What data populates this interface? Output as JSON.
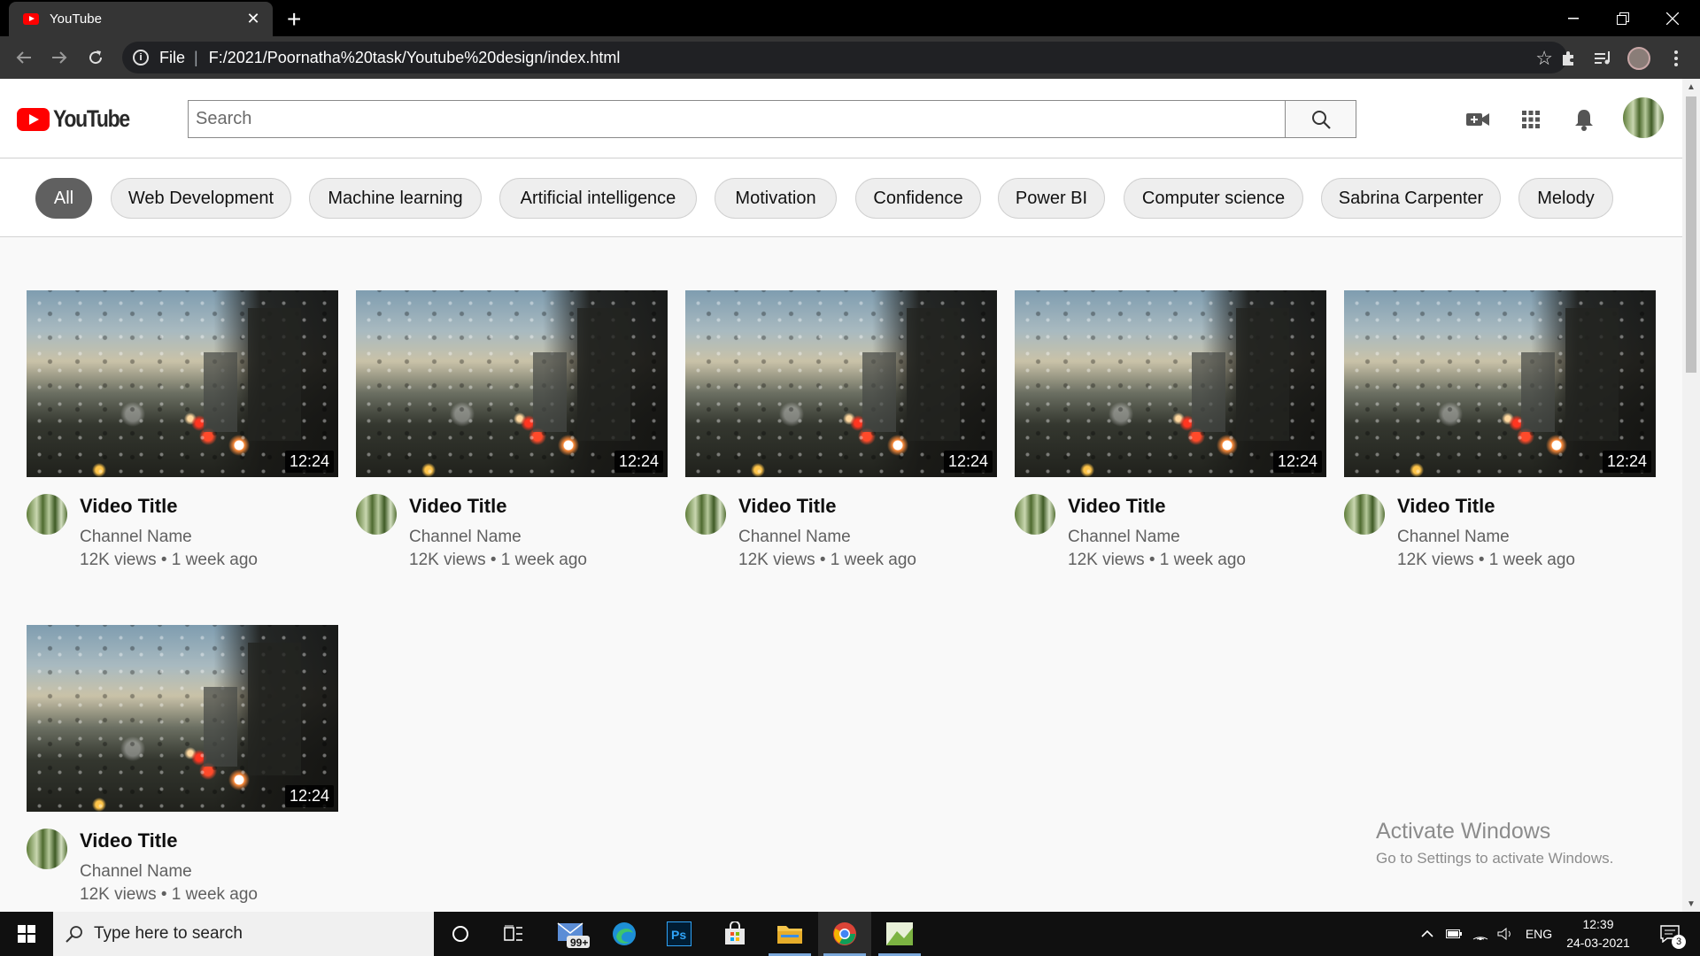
{
  "browser": {
    "tab_title": "YouTube",
    "url_scheme": "File",
    "url": "F:/2021/Poornatha%20task/Youtube%20design/index.html"
  },
  "header": {
    "logo_text": "YouTube",
    "search_placeholder": "Search"
  },
  "chips": [
    {
      "label": "All",
      "active": true
    },
    {
      "label": "Web Development"
    },
    {
      "label": "Machine learning"
    },
    {
      "label": "Artificial intelligence"
    },
    {
      "label": "Motivation"
    },
    {
      "label": "Confidence"
    },
    {
      "label": "Power BI"
    },
    {
      "label": "Computer science"
    },
    {
      "label": "Sabrina Carpenter"
    },
    {
      "label": "Melody"
    }
  ],
  "videos": [
    {
      "title": "Video Title",
      "channel": "Channel Name",
      "stats": "12K views • 1 week ago",
      "duration": "12:24"
    },
    {
      "title": "Video Title",
      "channel": "Channel Name",
      "stats": "12K views • 1 week ago",
      "duration": "12:24"
    },
    {
      "title": "Video Title",
      "channel": "Channel Name",
      "stats": "12K views • 1 week ago",
      "duration": "12:24"
    },
    {
      "title": "Video Title",
      "channel": "Channel Name",
      "stats": "12K views • 1 week ago",
      "duration": "12:24"
    },
    {
      "title": "Video Title",
      "channel": "Channel Name",
      "stats": "12K views • 1 week ago",
      "duration": "12:24"
    },
    {
      "title": "Video Title",
      "channel": "Channel Name",
      "stats": "12K views • 1 week ago",
      "duration": "12:24"
    }
  ],
  "watermark": {
    "line1": "Activate Windows",
    "line2": "Go to Settings to activate Windows."
  },
  "taskbar": {
    "search_placeholder": "Type here to search",
    "mail_badge": "99+",
    "language": "ENG",
    "time": "12:39",
    "date": "24-03-2021",
    "notification_count": "3"
  },
  "colors": {
    "brand_red": "#ff0000",
    "chip_active": "#606060",
    "chip_bg": "#eeeeee",
    "page_bg": "#f9f9f9"
  }
}
